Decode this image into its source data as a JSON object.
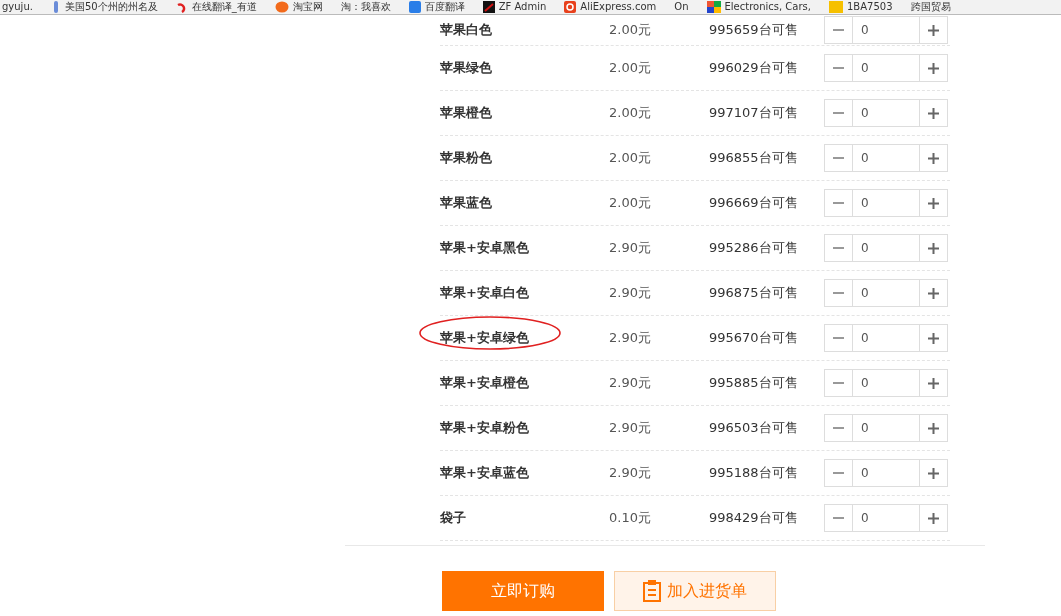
{
  "bookmarks": [
    {
      "label": "gyuju."
    },
    {
      "label": "美国50个州的州名及"
    },
    {
      "label": "在线翻译_有道"
    },
    {
      "label": "淘宝网"
    },
    {
      "label": "淘：我喜欢"
    },
    {
      "label": "百度翻译"
    },
    {
      "label": "ZF Admin"
    },
    {
      "label": "AliExpress.com"
    },
    {
      "label": "On"
    },
    {
      "label": "Electronics, Cars,"
    },
    {
      "label": "1BA7503"
    },
    {
      "label": "跨国贸易"
    }
  ],
  "items": [
    {
      "name": "苹果白色",
      "price": "2.00元",
      "stock": "995659台可售",
      "quantity": "0",
      "circled": false
    },
    {
      "name": "苹果绿色",
      "price": "2.00元",
      "stock": "996029台可售",
      "quantity": "0",
      "circled": false
    },
    {
      "name": "苹果橙色",
      "price": "2.00元",
      "stock": "997107台可售",
      "quantity": "0",
      "circled": false
    },
    {
      "name": "苹果粉色",
      "price": "2.00元",
      "stock": "996855台可售",
      "quantity": "0",
      "circled": false
    },
    {
      "name": "苹果蓝色",
      "price": "2.00元",
      "stock": "996669台可售",
      "quantity": "0",
      "circled": false
    },
    {
      "name": "苹果+安卓黑色",
      "price": "2.90元",
      "stock": "995286台可售",
      "quantity": "0",
      "circled": false
    },
    {
      "name": "苹果+安卓白色",
      "price": "2.90元",
      "stock": "996875台可售",
      "quantity": "0",
      "circled": false
    },
    {
      "name": "苹果+安卓绿色",
      "price": "2.90元",
      "stock": "995670台可售",
      "quantity": "0",
      "circled": true
    },
    {
      "name": "苹果+安卓橙色",
      "price": "2.90元",
      "stock": "995885台可售",
      "quantity": "0",
      "circled": false
    },
    {
      "name": "苹果+安卓粉色",
      "price": "2.90元",
      "stock": "996503台可售",
      "quantity": "0",
      "circled": false
    },
    {
      "name": "苹果+安卓蓝色",
      "price": "2.90元",
      "stock": "995188台可售",
      "quantity": "0",
      "circled": false
    },
    {
      "name": "袋子",
      "price": "0.10元",
      "stock": "998429台可售",
      "quantity": "0",
      "circled": false
    }
  ],
  "buttons": [
    {
      "label": "立即订购",
      "kind": "primary"
    },
    {
      "label": "加入进货单",
      "kind": "secondary"
    }
  ]
}
